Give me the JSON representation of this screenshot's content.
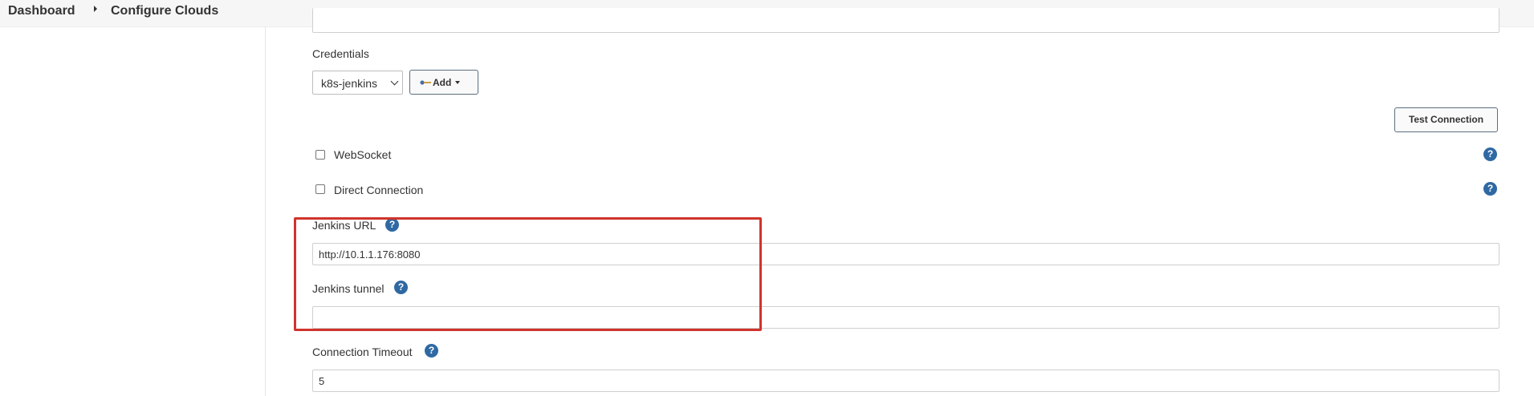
{
  "breadcrumb": {
    "dashboard": "Dashboard",
    "current": "Configure Clouds"
  },
  "credentials": {
    "label": "Credentials",
    "selected": "k8s-jenkins",
    "add_label": "Add"
  },
  "test_connection_label": "Test Connection",
  "websocket": {
    "label": "WebSocket",
    "checked": false
  },
  "direct_connection": {
    "label": "Direct Connection",
    "checked": false
  },
  "jenkins_url": {
    "label": "Jenkins URL",
    "value": "http://10.1.1.176:8080"
  },
  "jenkins_tunnel": {
    "label": "Jenkins tunnel",
    "value": ""
  },
  "connection_timeout": {
    "label": "Connection Timeout",
    "value": "5"
  },
  "help_glyph": "?",
  "colors": {
    "help": "#2f69a3",
    "highlight": "#d0342c",
    "key_icon": "#4a6fa5"
  },
  "icons": {
    "add_button": "key-icon",
    "help": "help-icon"
  }
}
